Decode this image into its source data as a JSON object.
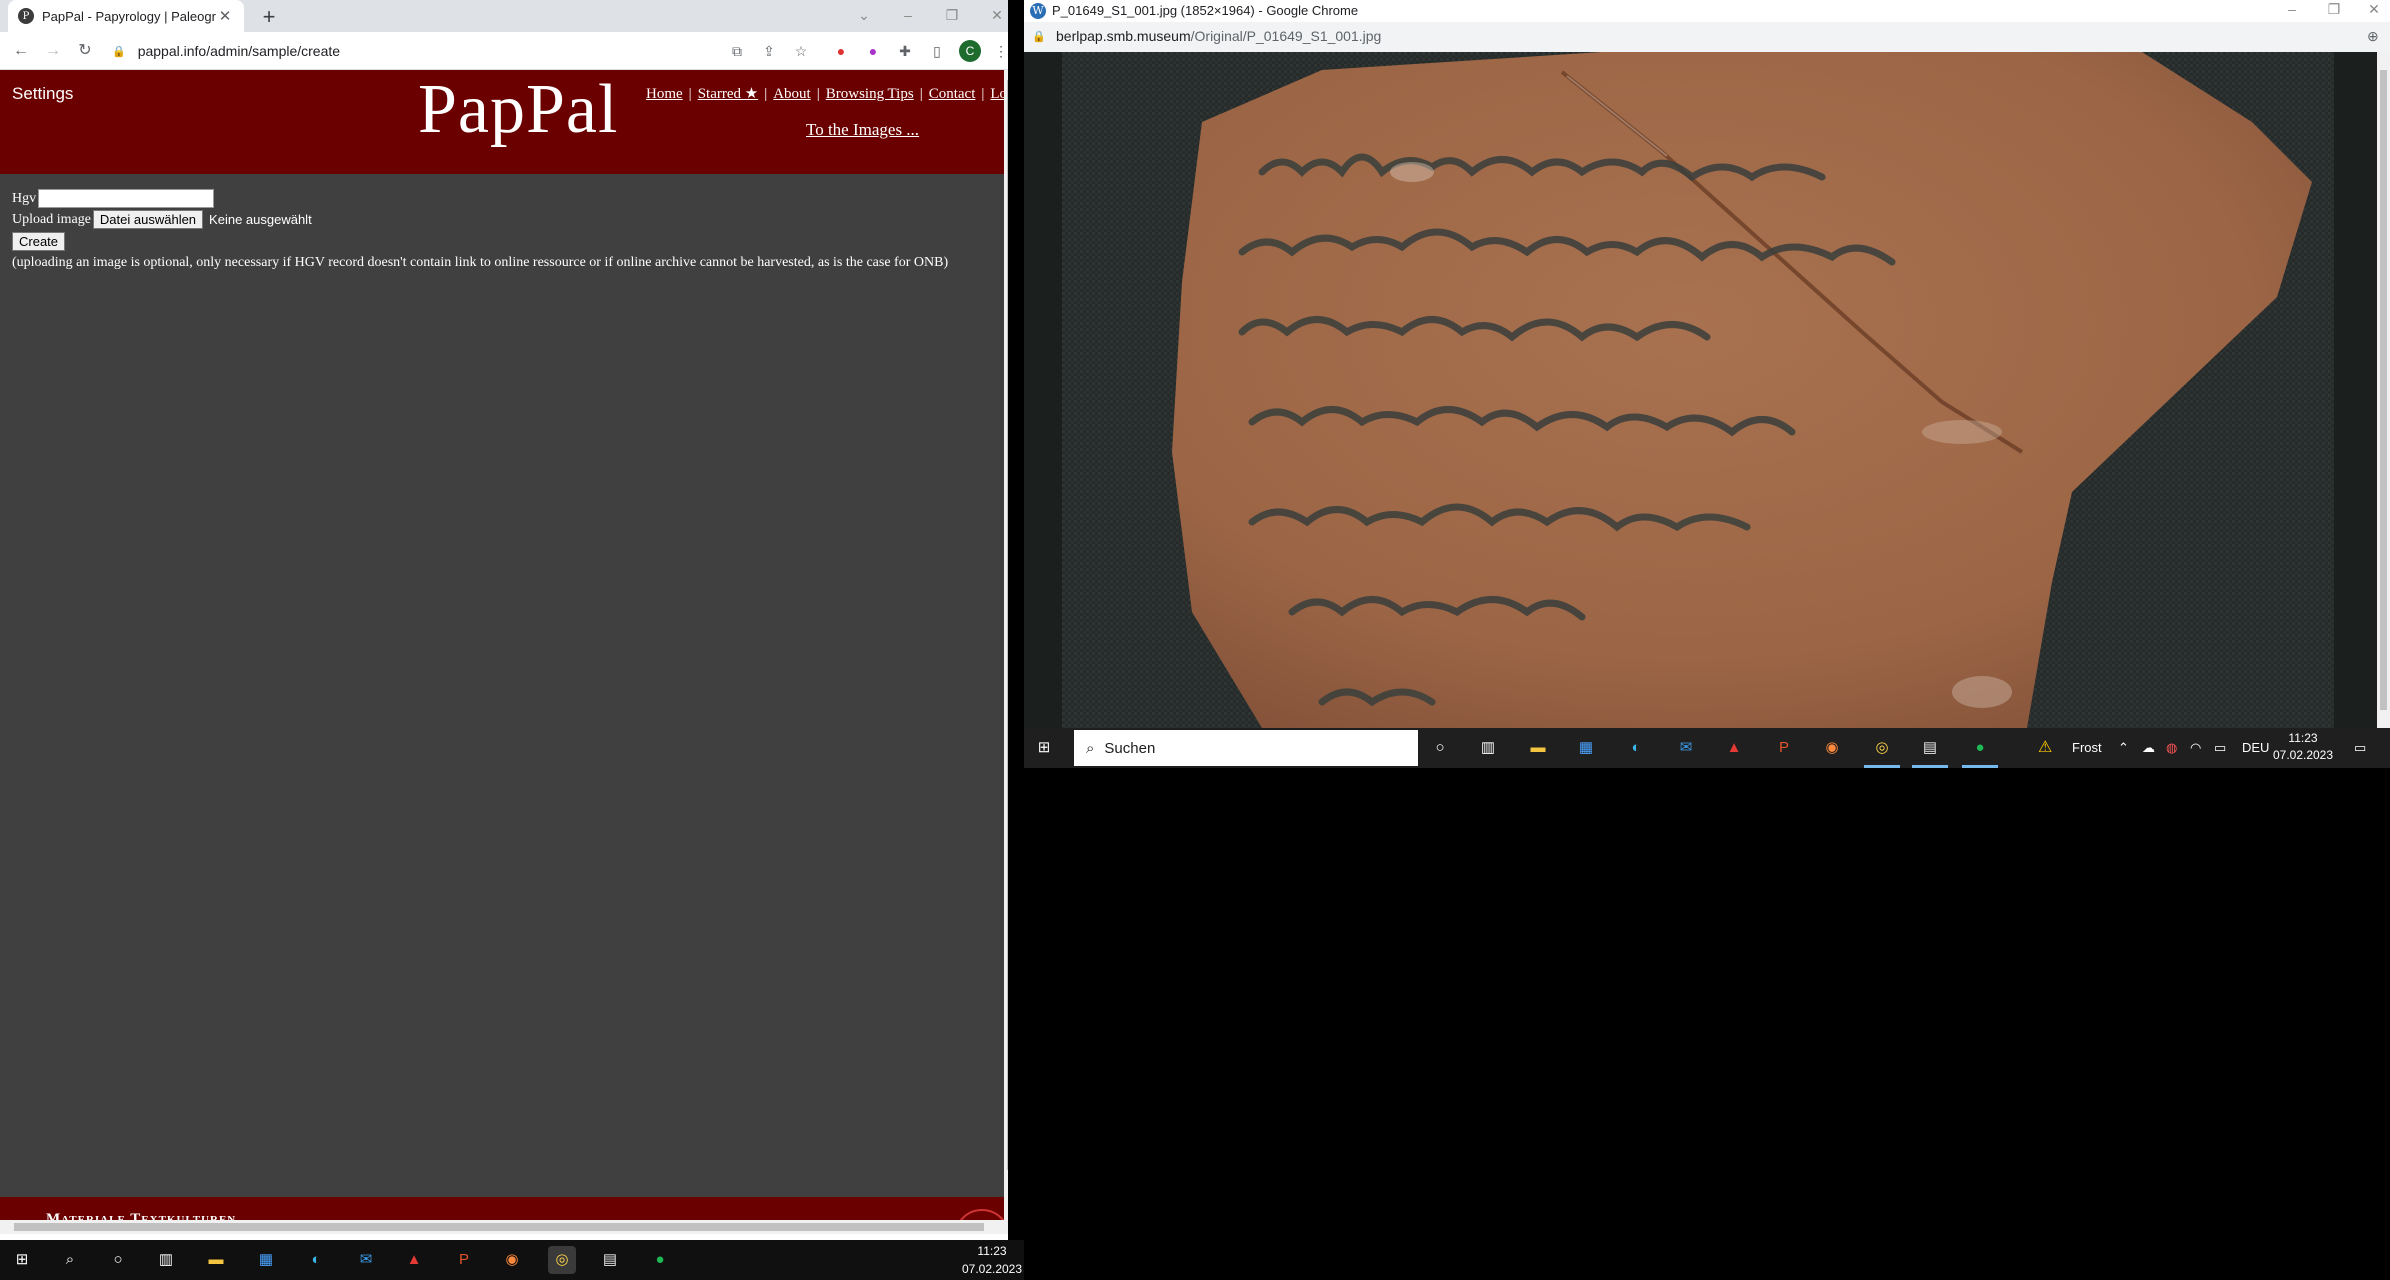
{
  "left_window": {
    "tab_title": "PapPal - Papyrology | Paleograph",
    "favicon_letter": "P",
    "url": "pappal.info/admin/sample/create",
    "avatar_letter": "C",
    "site": {
      "settings": "Settings",
      "logo": "PapPal",
      "nav": [
        "Home",
        "Starred ★",
        "About",
        "Browsing Tips",
        "Contact",
        "Logout"
      ],
      "to_images": "To the Images ...",
      "form": {
        "hgv_label": "Hgv",
        "hgv_value": "",
        "upload_label": "Upload image",
        "file_button": "Datei auswählen",
        "file_status": "Keine ausgewählt",
        "create_button": "Create",
        "note": "(uploading an image is optional, only necessary if HGV record doesn't contain link to online ressource or if online archive cannot be harvested, as is the case for ONB)"
      },
      "footer": "Materiale Textkulturen"
    },
    "taskbar_clock": {
      "time": "11:23",
      "date": "07.02.2023"
    }
  },
  "right_window": {
    "title": "P_01649_S1_001.jpg (1852×1964) - Google Chrome",
    "url_host": "berlpap.smb.museum",
    "url_path": "/Original/P_01649_S1_001.jpg",
    "photo_alt": "ostracon fragment with dark ink Greek writing",
    "taskbar": {
      "search_placeholder": "Suchen",
      "weather": "Frost",
      "language": "DEU",
      "time": "11:23",
      "date": "07.02.2023"
    }
  },
  "colors": {
    "pappal_red": "#6b0000",
    "page_bg": "#404040",
    "ostracon": "#a06a4c",
    "ink": "#3a3f3c"
  }
}
